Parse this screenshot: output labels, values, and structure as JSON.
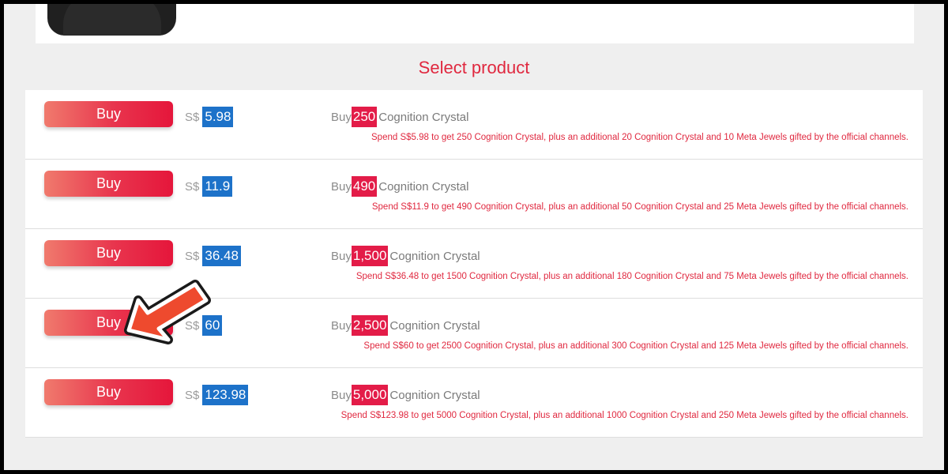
{
  "section_title": "Select product",
  "products": [
    {
      "button": "Buy",
      "currency": "S$",
      "price": "5.98",
      "buy_word": "Buy",
      "amount": "250",
      "item": "Cognition Crystal",
      "note": "Spend S$5.98 to get 250 Cognition Crystal, plus an additional 20 Cognition Crystal and 10 Meta Jewels gifted by the official channels."
    },
    {
      "button": "Buy",
      "currency": "S$",
      "price": "11.9",
      "buy_word": "Buy",
      "amount": "490",
      "item": "Cognition Crystal",
      "note": "Spend S$11.9 to get 490 Cognition Crystal, plus an additional 50 Cognition Crystal and 25 Meta Jewels gifted by the official channels."
    },
    {
      "button": "Buy",
      "currency": "S$",
      "price": "36.48",
      "buy_word": "Buy",
      "amount": "1,500",
      "item": "Cognition Crystal",
      "note": "Spend S$36.48 to get 1500 Cognition Crystal, plus an additional 180 Cognition Crystal and 75 Meta Jewels gifted by the official channels."
    },
    {
      "button": "Buy",
      "currency": "S$",
      "price": "60",
      "buy_word": "Buy",
      "amount": "2,500",
      "item": "Cognition Crystal",
      "note": "Spend S$60 to get 2500 Cognition Crystal, plus an additional 300 Cognition Crystal and 125 Meta Jewels gifted by the official channels."
    },
    {
      "button": "Buy",
      "currency": "S$",
      "price": "123.98",
      "buy_word": "Buy",
      "amount": "5,000",
      "item": "Cognition Crystal",
      "note": "Spend S$123.98 to get 5000 Cognition Crystal, plus an additional 1000 Cognition Crystal and 250 Meta Jewels gifted by the official channels."
    }
  ],
  "colors": {
    "accent_red": "#e0283f",
    "price_blue": "#1d72c9",
    "amount_red": "#e31c48",
    "pointer_arrow": "#ee4a2e"
  },
  "icons": {
    "avatar": "character-avatar",
    "pointer": "arrow-pointer-icon"
  }
}
